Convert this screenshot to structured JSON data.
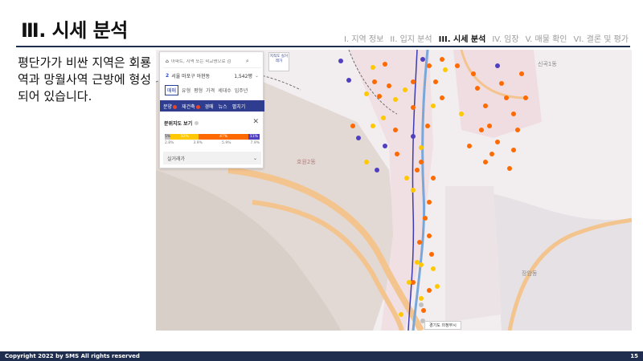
{
  "slide": {
    "title": "Ⅲ. 시세 분석",
    "body": "평단가가 비싼 지역은 회룡역과 망월사역 근방에 형성되어 있습니다.",
    "footer": "Copyright 2022 by SMS  All rights reserved",
    "page_number": "15"
  },
  "nav": [
    {
      "label": "I. 지역 정보",
      "active": false
    },
    {
      "label": "II. 입지 분석",
      "active": false
    },
    {
      "label": "III. 시세 분석",
      "active": true
    },
    {
      "label": "IV. 임장",
      "active": false
    },
    {
      "label": "V. 매물 확인",
      "active": false
    },
    {
      "label": "VI. 결론 및 평가",
      "active": false
    }
  ],
  "map_ui": {
    "search_placeholder": "아파트, 지역 또는 학교명으로 검",
    "location_num": "2",
    "location": "서울 마포구 아현동",
    "location_value": "1,542평",
    "filters": [
      "매매",
      "유형",
      "평형",
      "가격",
      "세대수",
      "입주년"
    ],
    "tabs": [
      "분양",
      "재건축",
      "경매",
      "뉴스",
      "펼치기"
    ],
    "legend_title": "분위지도 보기",
    "legend_segments": [
      "5%",
      "33%",
      "47%",
      "11%"
    ],
    "legend_ticks": [
      "2.8%",
      "3.9%",
      "5.9%",
      "7.9%"
    ],
    "real_price_label": "실거래가",
    "real_price_button": "지적도 실거래가",
    "map_labels": [
      "호원2동",
      "장암동",
      "신곡1동"
    ],
    "gyeonggi_button": "경기도 의정부시"
  },
  "colors": {
    "navy": "#1f2e4f",
    "legend": [
      "#c0c0c0",
      "#ffc800",
      "#ff6a00",
      "#5040c0"
    ]
  }
}
